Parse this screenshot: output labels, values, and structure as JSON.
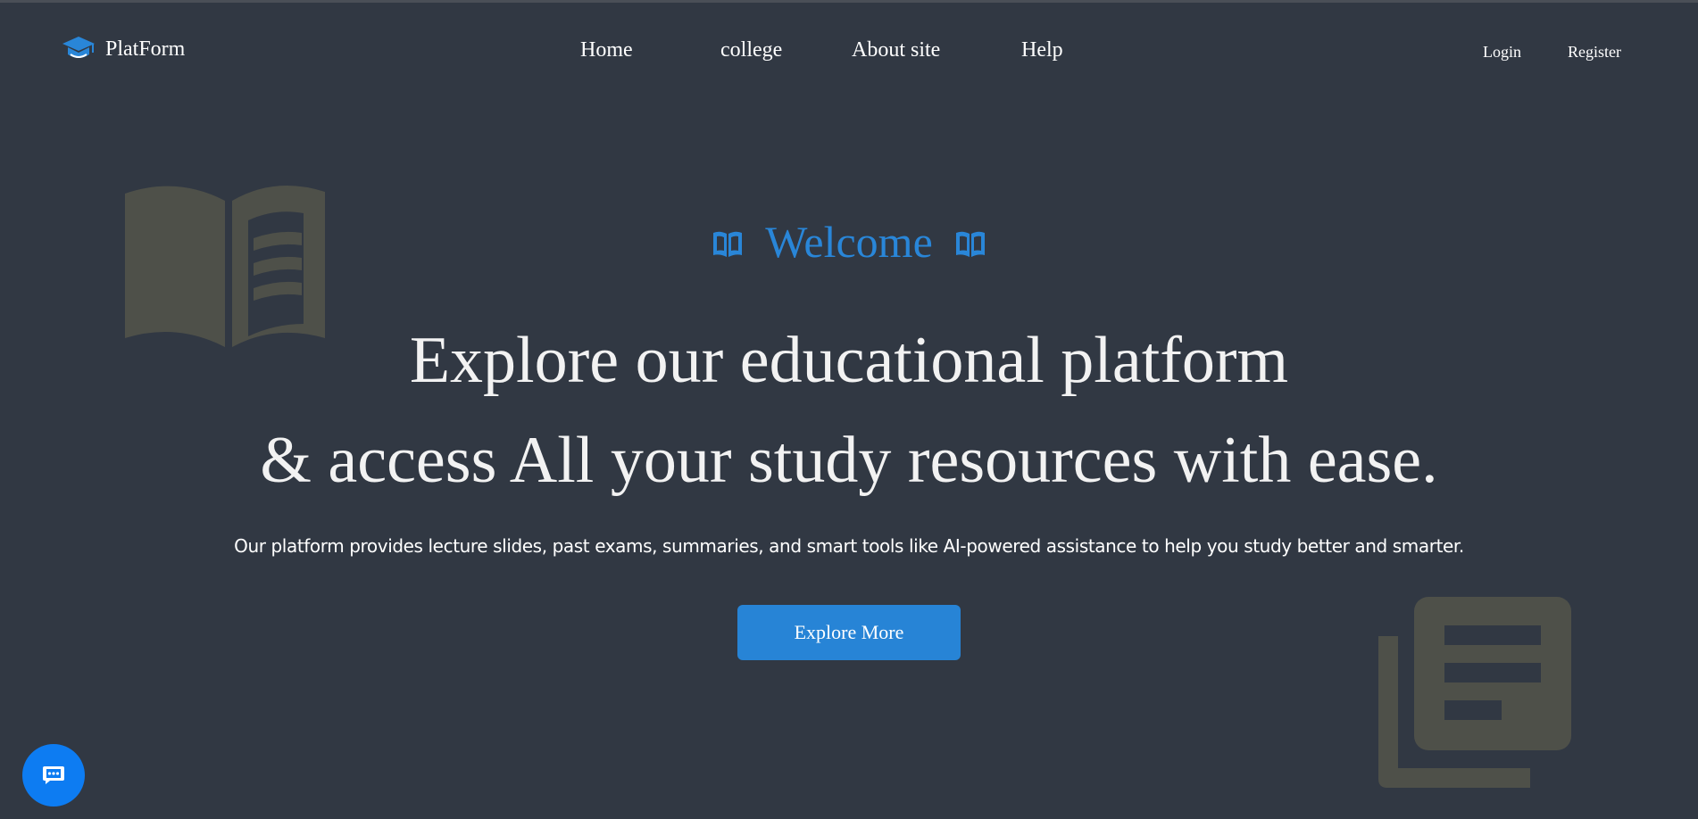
{
  "brand": {
    "name": "PlatForm",
    "logo_icon": "graduation-cap-icon"
  },
  "nav": {
    "items": [
      {
        "label": "Home"
      },
      {
        "label": "college"
      },
      {
        "label": "About site"
      },
      {
        "label": "Help"
      }
    ]
  },
  "auth": {
    "login": "Login",
    "register": "Register"
  },
  "hero": {
    "welcome": "Welcome",
    "welcome_icon": "open-book-icon",
    "headline_line1": "Explore our educational platform",
    "headline_line2": "& access All your study resources with ease.",
    "description": "Our platform provides lecture slides, past exams, summaries, and smart tools like AI-powered assistance to help you study better and smarter.",
    "cta_label": "Explore More"
  },
  "decorations": {
    "left_icon": "book-icon",
    "right_icon": "library-books-icon"
  },
  "chat": {
    "icon": "chat-bubble-icon"
  },
  "colors": {
    "background": "#313843",
    "accent": "#2784d6",
    "chat_button": "#0d7cf2",
    "decorative": "#4e5049",
    "text": "#ffffff"
  }
}
